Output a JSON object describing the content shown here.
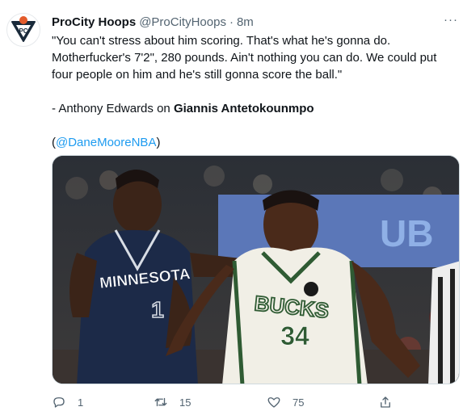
{
  "tweet": {
    "display_name": "ProCity Hoops",
    "handle": "@ProCityHoops",
    "separator": "·",
    "time": "8m",
    "more_icon": "more-dots-icon",
    "logo_text": "PC",
    "text_line1": "\"You can't stress about him scoring. That's what he's gonna do.",
    "text_line2": "Motherfucker's 7'2\", 280 pounds. Ain't nothing you can do. We could put",
    "text_line3": "four people on him and he's still gonna score the ball.\"",
    "attribution_prefix": "- Anthony Edwards on ",
    "attribution_name": "Giannis Antetokounmpo",
    "mention_open": "(",
    "mention": "@DaneMooreNBA",
    "mention_close": ")"
  },
  "media": {
    "jersey_left_team": "MINNESOTA",
    "jersey_left_number": "1",
    "jersey_right_team": "BUCKS",
    "jersey_right_number": "34",
    "banner_text": "UB",
    "colors": {
      "timberwolves_navy": "#1c2a48",
      "bucks_green": "#2f5b33",
      "bucks_cream": "#f1efe6",
      "banner_blue": "#5b77b8"
    }
  },
  "actions": {
    "reply": {
      "icon": "reply-icon",
      "count": "1"
    },
    "retweet": {
      "icon": "retweet-icon",
      "count": "15"
    },
    "like": {
      "icon": "heart-icon",
      "count": "75"
    },
    "share": {
      "icon": "share-icon"
    }
  }
}
